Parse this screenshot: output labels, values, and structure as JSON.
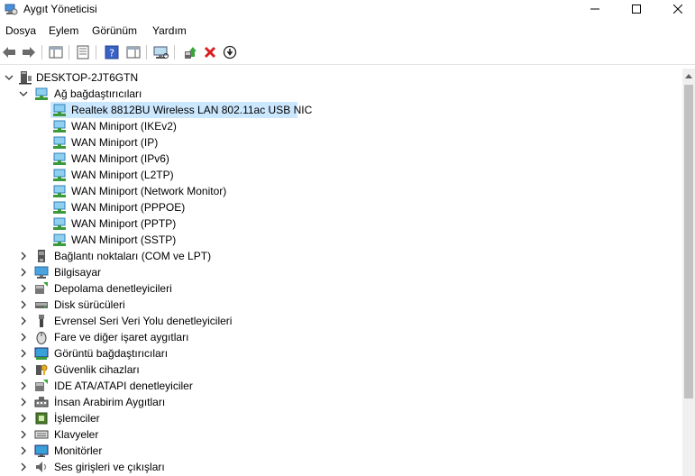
{
  "window": {
    "title": "Aygıt Yöneticisi"
  },
  "menu": [
    "Dosya",
    "Eylem",
    "Görünüm",
    "Yardım"
  ],
  "toolbar": {
    "icons": [
      "back-arrow-icon",
      "forward-arrow-icon",
      "show-hide-console-tree-icon",
      "properties-icon",
      "help-icon",
      "action-pane-icon",
      "scan-hardware-icon",
      "update-driver-icon",
      "uninstall-device-icon",
      "disable-device-icon"
    ],
    "colors": {
      "uninstall": "#d81e1e",
      "green": "#3aa53a"
    }
  },
  "tree": {
    "root": "DESKTOP-2JT6GTN",
    "network_category": "Ağ bağdaştırıcıları",
    "network_devices": [
      "Realtek 8812BU Wireless LAN 802.11ac USB NIC",
      "WAN Miniport (IKEv2)",
      "WAN Miniport (IP)",
      "WAN Miniport (IPv6)",
      "WAN Miniport (L2TP)",
      "WAN Miniport (Network Monitor)",
      "WAN Miniport (PPPOE)",
      "WAN Miniport (PPTP)",
      "WAN Miniport (SSTP)"
    ],
    "categories": [
      "Bağlantı noktaları (COM ve LPT)",
      "Bilgisayar",
      "Depolama denetleyicileri",
      "Disk sürücüleri",
      "Evrensel Seri Veri Yolu denetleyicileri",
      "Fare ve diğer işaret aygıtları",
      "Görüntü bağdaştırıcıları",
      "Güvenlik cihazları",
      "IDE ATA/ATAPI denetleyiciler",
      "İnsan Arabirim Aygıtları",
      "İşlemciler",
      "Klavyeler",
      "Monitörler",
      "Ses girişleri ve çıkışları"
    ],
    "category_icons": [
      "port-icon",
      "computer-icon",
      "storage-controller-icon",
      "disk-drive-icon",
      "usb-icon",
      "mouse-icon",
      "display-adapter-icon",
      "security-key-icon",
      "ide-controller-icon",
      "hid-icon",
      "processor-icon",
      "keyboard-icon",
      "monitor-icon",
      "audio-icon"
    ],
    "selected_color": "#cce8ff"
  }
}
